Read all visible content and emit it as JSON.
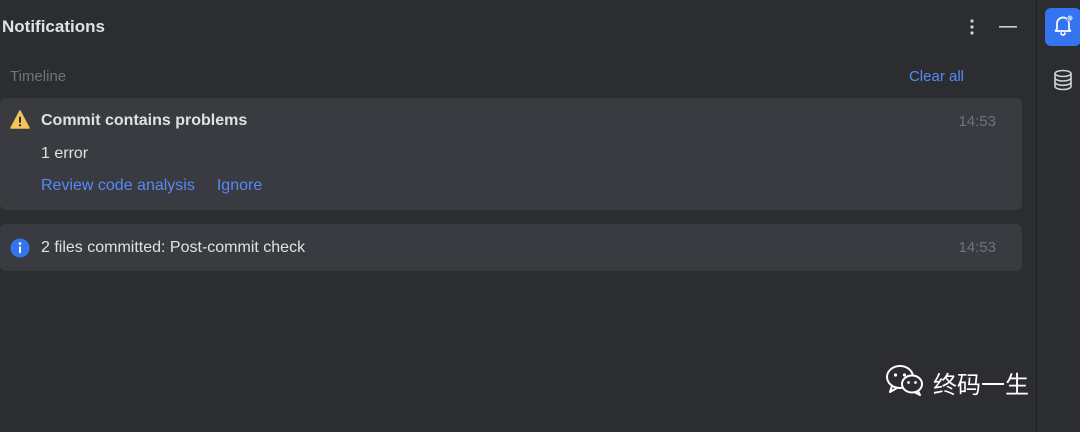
{
  "header": {
    "title": "Notifications"
  },
  "timeline": {
    "label": "Timeline",
    "clear_all": "Clear all"
  },
  "notifications": [
    {
      "icon": "warning-icon",
      "title": "Commit contains problems",
      "body": "1 error",
      "actions": [
        "Review code analysis",
        "Ignore"
      ],
      "time": "14:53"
    },
    {
      "icon": "info-icon",
      "title": "2 files committed: Post-commit check",
      "time": "14:53"
    }
  ],
  "sidebar": {
    "items": [
      {
        "icon": "bell-icon",
        "active": true
      },
      {
        "icon": "database-icon",
        "active": false
      }
    ]
  },
  "watermark": {
    "icon": "wechat-icon",
    "text": "终码一生"
  },
  "colors": {
    "background": "#2b2d30",
    "card": "#393b40",
    "link": "#548af7",
    "warning": "#f2c55c",
    "info": "#3574f0",
    "active_tool": "#3574f0"
  }
}
